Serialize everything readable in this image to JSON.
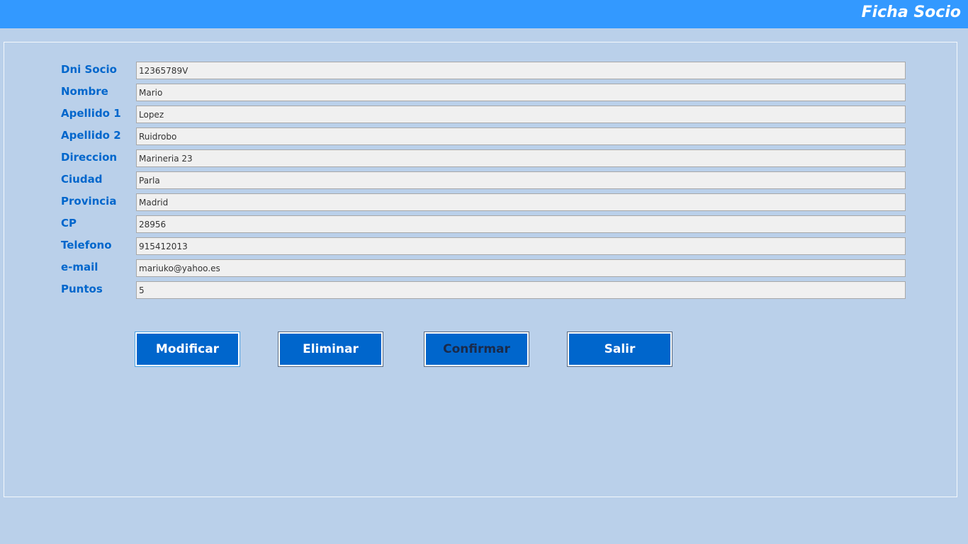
{
  "header": {
    "title": "Ficha Socio",
    "background": "#3399ff"
  },
  "form": {
    "fields": [
      {
        "label": "Dni Socio",
        "value": "12365789V"
      },
      {
        "label": "Nombre",
        "value": "Mario"
      },
      {
        "label": "Apellido 1",
        "value": "Lopez"
      },
      {
        "label": "Apellido 2",
        "value": "Ruidrobo"
      },
      {
        "label": "Direccion",
        "value": "Marineria 23"
      },
      {
        "label": "Ciudad",
        "value": "Parla"
      },
      {
        "label": "Provincia",
        "value": "Madrid"
      },
      {
        "label": "CP",
        "value": "28956"
      },
      {
        "label": "Telefono",
        "value": "915412013"
      },
      {
        "label": "e-mail",
        "value": "mariuko@yahoo.es"
      },
      {
        "label": "Puntos",
        "value": "5"
      }
    ]
  },
  "buttons": {
    "modificar": "Modificar",
    "eliminar": "Eliminar",
    "confirmar": "Confirmar",
    "salir": "Salir"
  },
  "colors": {
    "background": "#bad0ea",
    "label": "#0066cc",
    "button": "#0066cc"
  }
}
